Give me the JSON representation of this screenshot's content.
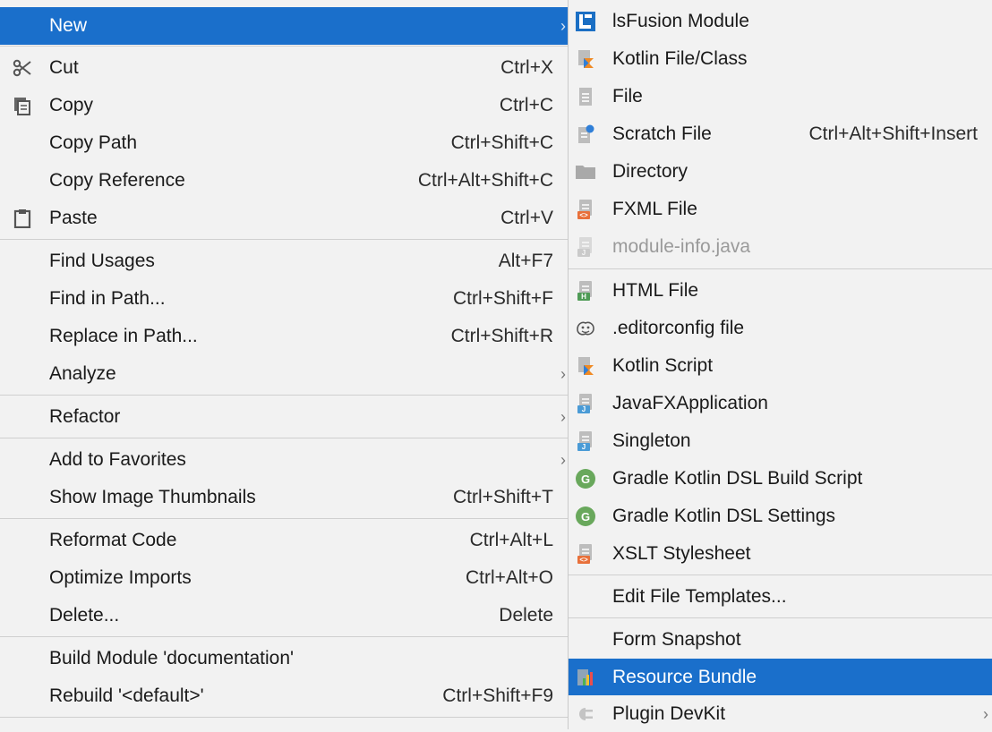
{
  "left_menu": {
    "new": {
      "label": "New"
    },
    "cut": {
      "label": "Cut",
      "shortcut": "Ctrl+X"
    },
    "copy": {
      "label": "Copy",
      "shortcut": "Ctrl+C"
    },
    "copy_path": {
      "label": "Copy Path",
      "shortcut": "Ctrl+Shift+C"
    },
    "copy_reference": {
      "label": "Copy Reference",
      "shortcut": "Ctrl+Alt+Shift+C"
    },
    "paste": {
      "label": "Paste",
      "shortcut": "Ctrl+V"
    },
    "find_usages": {
      "label": "Find Usages",
      "shortcut": "Alt+F7"
    },
    "find_in_path": {
      "label": "Find in Path...",
      "shortcut": "Ctrl+Shift+F"
    },
    "replace_in_path": {
      "label": "Replace in Path...",
      "shortcut": "Ctrl+Shift+R"
    },
    "analyze": {
      "label": "Analyze"
    },
    "refactor": {
      "label": "Refactor"
    },
    "add_to_favorites": {
      "label": "Add to Favorites"
    },
    "show_thumbnails": {
      "label": "Show Image Thumbnails",
      "shortcut": "Ctrl+Shift+T"
    },
    "reformat_code": {
      "label": "Reformat Code",
      "shortcut": "Ctrl+Alt+L"
    },
    "optimize_imports": {
      "label": "Optimize Imports",
      "shortcut": "Ctrl+Alt+O"
    },
    "delete": {
      "label": "Delete...",
      "shortcut": "Delete"
    },
    "build_module": {
      "label": "Build Module 'documentation'"
    },
    "rebuild": {
      "label": "Rebuild '<default>'",
      "shortcut": "Ctrl+Shift+F9"
    }
  },
  "right_menu": {
    "lsfusion_module": {
      "label": "lsFusion Module"
    },
    "kotlin_file": {
      "label": "Kotlin File/Class"
    },
    "file": {
      "label": "File"
    },
    "scratch_file": {
      "label": "Scratch File",
      "shortcut": "Ctrl+Alt+Shift+Insert"
    },
    "directory": {
      "label": "Directory"
    },
    "fxml_file": {
      "label": "FXML File"
    },
    "module_info": {
      "label": "module-info.java"
    },
    "html_file": {
      "label": "HTML File"
    },
    "editorconfig": {
      "label": ".editorconfig file"
    },
    "kotlin_script": {
      "label": "Kotlin Script"
    },
    "javafx_app": {
      "label": "JavaFXApplication"
    },
    "singleton": {
      "label": "Singleton"
    },
    "gradle_build": {
      "label": "Gradle Kotlin DSL Build Script"
    },
    "gradle_settings": {
      "label": "Gradle Kotlin DSL Settings"
    },
    "xslt": {
      "label": "XSLT Stylesheet"
    },
    "edit_templates": {
      "label": "Edit File Templates..."
    },
    "form_snapshot": {
      "label": "Form Snapshot"
    },
    "resource_bundle": {
      "label": "Resource Bundle"
    },
    "plugin_devkit": {
      "label": "Plugin DevKit"
    }
  },
  "icons": {
    "gradle_letter": "G",
    "html_badge": "H",
    "xml_badge": "<>",
    "java_badge": "J"
  },
  "colors": {
    "highlight": "#1a6fcb",
    "menu_background": "#f2f2f2",
    "separator": "#cfcfcf",
    "disabled_text": "#9a9a9a",
    "gradle_green": "#69a85c",
    "kotlin_orange": "#f08a24",
    "kotlin_blue": "#2f7fd8"
  }
}
